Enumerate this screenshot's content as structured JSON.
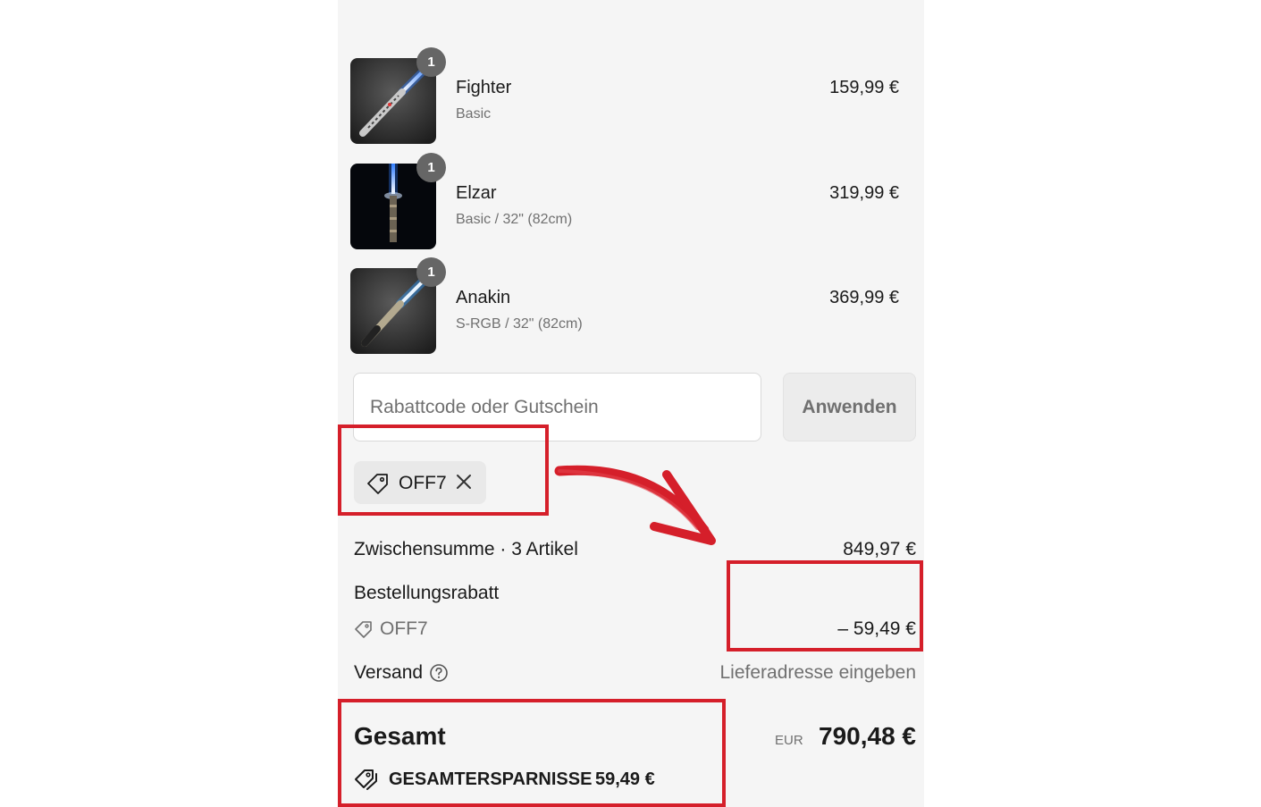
{
  "items": [
    {
      "name": "Fighter",
      "variant": "Basic",
      "price": "159,99 €",
      "quantity": "1",
      "image": "lightsaber-fighter-icon"
    },
    {
      "name": "Elzar",
      "variant": "Basic / 32\" (82cm)",
      "price": "319,99 €",
      "quantity": "1",
      "image": "lightsaber-elzar-icon"
    },
    {
      "name": "Anakin",
      "variant": "S-RGB / 32\" (82cm)",
      "price": "369,99 €",
      "quantity": "1",
      "image": "lightsaber-anakin-icon"
    }
  ],
  "discount": {
    "placeholder": "Rabattcode oder Gutschein",
    "value": "",
    "apply_label": "Anwenden",
    "applied_code": "OFF7"
  },
  "summary": {
    "subtotal_label": "Zwischensumme · 3 Artikel",
    "subtotal_value": "849,97 €",
    "discount_label": "Bestellungsrabatt",
    "discount_code": "OFF7",
    "discount_value": "– 59,49 €",
    "shipping_label": "Versand",
    "shipping_value": "Lieferadresse eingeben",
    "total_label": "Gesamt",
    "currency": "EUR",
    "total_value": "790,48 €",
    "savings_label": "GESAMTERSPARNISSE",
    "savings_value": "59,49 €"
  },
  "colors": {
    "panel_bg": "#f5f5f5",
    "annotation_red": "#d51f2a",
    "muted_text": "#707070",
    "saber_blue": "#3b8dff"
  }
}
